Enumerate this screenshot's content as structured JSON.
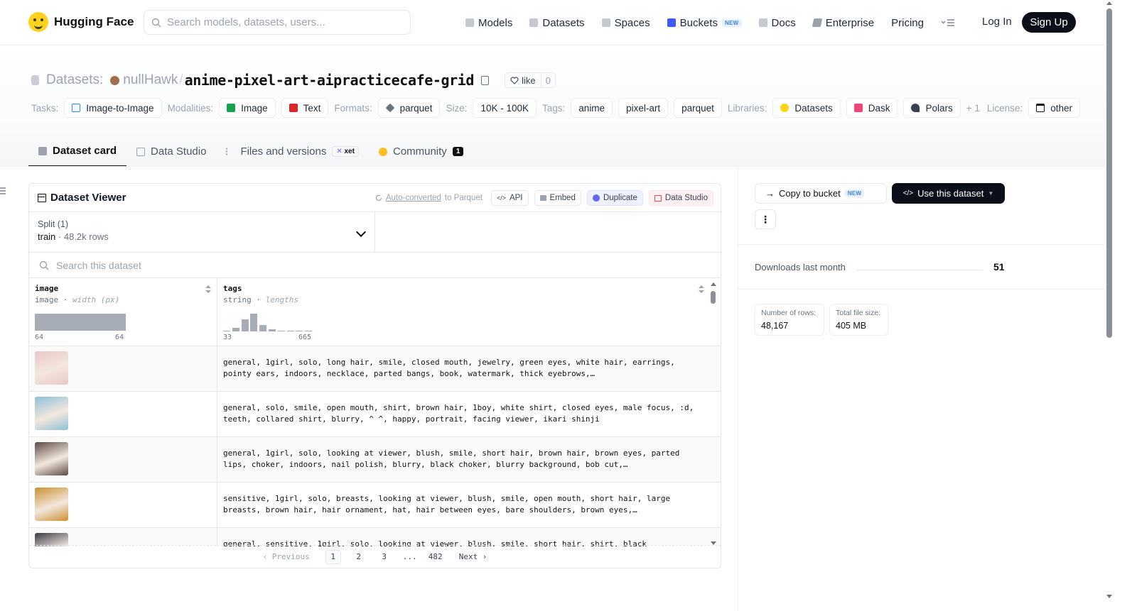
{
  "nav": {
    "brand": "Hugging Face",
    "search_placeholder": "Search models, datasets, users...",
    "items": [
      {
        "label": "Models",
        "icon": "models-icon"
      },
      {
        "label": "Datasets",
        "icon": "datasets-icon"
      },
      {
        "label": "Spaces",
        "icon": "spaces-icon"
      },
      {
        "label": "Buckets",
        "icon": "buckets-icon",
        "badge": "NEW"
      },
      {
        "label": "Docs",
        "icon": "docs-icon"
      },
      {
        "label": "Enterprise",
        "icon": "enterprise-icon"
      },
      {
        "label": "Pricing"
      }
    ],
    "login": "Log In",
    "signup": "Sign Up"
  },
  "header": {
    "crumb_label": "Datasets:",
    "owner": "nullHawk",
    "separator": "/",
    "repo": "anime-pixel-art-aipracticecafe-grid",
    "like_label": "like",
    "like_count": "0"
  },
  "tags": {
    "tasks_label": "Tasks:",
    "tasks": [
      "Image-to-Image"
    ],
    "modalities_label": "Modalities:",
    "modalities": [
      "Image",
      "Text"
    ],
    "formats_label": "Formats:",
    "formats": [
      "parquet"
    ],
    "size_label": "Size:",
    "size": "10K - 100K",
    "tags_label": "Tags:",
    "tags": [
      "anime",
      "pixel-art",
      "parquet"
    ],
    "libraries_label": "Libraries:",
    "libraries": [
      "Datasets",
      "Dask",
      "Polars"
    ],
    "libraries_more": "+ 1",
    "license_label": "License:",
    "license": "other"
  },
  "tabs": [
    {
      "label": "Dataset card",
      "active": true
    },
    {
      "label": "Data Studio"
    },
    {
      "label": "Files and versions",
      "badge": "xet"
    },
    {
      "label": "Community",
      "count": "1"
    }
  ],
  "viewer": {
    "title": "Dataset Viewer",
    "auto_converted": "Auto-converted",
    "to_parquet": "to Parquet",
    "api": "API",
    "embed": "Embed",
    "duplicate": "Duplicate",
    "data_studio": "Data Studio",
    "split_label": "Split (1)",
    "split_name": "train",
    "split_rows": "48.2k rows",
    "search_placeholder": "Search this dataset",
    "columns": [
      {
        "name": "image",
        "type": "image",
        "stat": "width (px)",
        "min": "64",
        "max": "64"
      },
      {
        "name": "tags",
        "type": "string",
        "stat": "lengths",
        "min": "33",
        "max": "665"
      }
    ],
    "tags_histogram": [
      0.05,
      0.22,
      0.68,
      1.0,
      0.38,
      0.14,
      0.05,
      0.05,
      0.05,
      0.05
    ],
    "rows": [
      "general, 1girl, solo, long hair, smile, closed mouth, jewelry, green eyes, white hair, earrings, pointy ears, indoors, necklace, parted bangs, book, watermark, thick eyebrows,…",
      "general, solo, smile, open mouth, shirt, brown hair, 1boy, white shirt, closed eyes, male focus, :d, teeth, collared shirt, blurry, ^ ^, happy, portrait, facing viewer, ikari shinji",
      "general, 1girl, solo, looking at viewer, blush, smile, short hair, brown hair, brown eyes, parted lips, choker, indoors, nail polish, blurry, black choker, blurry background, bob cut,…",
      "sensitive, 1girl, solo, breasts, looking at viewer, blush, smile, open mouth, short hair, large breasts, brown hair, hair ornament, hat, hair between eyes, bare shoulders, brown eyes,…",
      "general, sensitive, 1girl, solo, looking at viewer, blush, smile, short hair, shirt, black"
    ],
    "thumb_colors": [
      "#e9c7c8",
      "#8ec0d8",
      "#5b4b45",
      "#c9902e",
      "#3b3b45"
    ],
    "pager": {
      "prev": "Previous",
      "pages": [
        "1",
        "2",
        "3",
        "...",
        "482"
      ],
      "next": "Next"
    }
  },
  "right": {
    "copy_to_bucket": "Copy to bucket",
    "new_badge": "NEW",
    "use_dataset": "Use this dataset",
    "more": "⋮",
    "downloads_label": "Downloads last month",
    "downloads_value": "51",
    "rows_label": "Number of rows:",
    "rows_value": "48,167",
    "size_label": "Total file size:",
    "size_value": "405 MB"
  }
}
